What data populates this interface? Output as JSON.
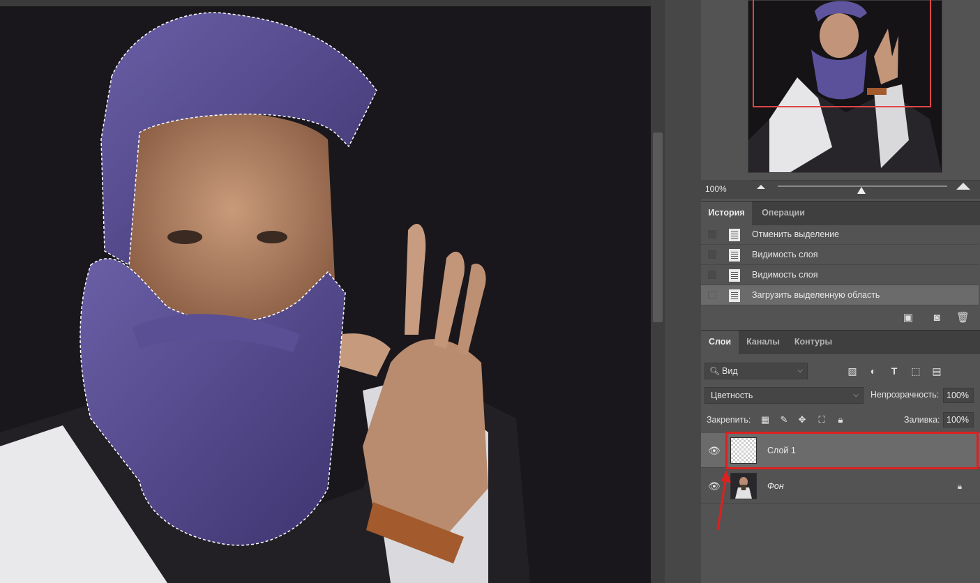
{
  "navigator": {
    "zoom": "100%"
  },
  "history": {
    "tabs": [
      "История",
      "Операции"
    ],
    "items": [
      {
        "label": "Отменить выделение",
        "icon": "document-icon",
        "selected": false
      },
      {
        "label": "Видимость слоя",
        "icon": "document-icon",
        "selected": false
      },
      {
        "label": "Видимость слоя",
        "icon": "document-icon",
        "selected": false
      },
      {
        "label": "Загрузить выделенную область",
        "icon": "document-icon",
        "selected": true
      }
    ]
  },
  "layers": {
    "tabs": [
      "Слои",
      "Каналы",
      "Контуры"
    ],
    "filter": "Вид",
    "blend_mode": "Цветность",
    "opacity_label": "Непрозрачность:",
    "opacity": "100%",
    "lock_label": "Закрепить:",
    "fill_label": "Заливка:",
    "fill": "100%",
    "items": [
      {
        "name": "Слой 1",
        "selected": true,
        "visible": true
      },
      {
        "name": "Фон",
        "selected": false,
        "visible": true,
        "locked": true
      }
    ]
  },
  "colors": {
    "annotation": "#e01f1f",
    "purple_tint": "#4b3f7f",
    "panel": "#535353"
  }
}
